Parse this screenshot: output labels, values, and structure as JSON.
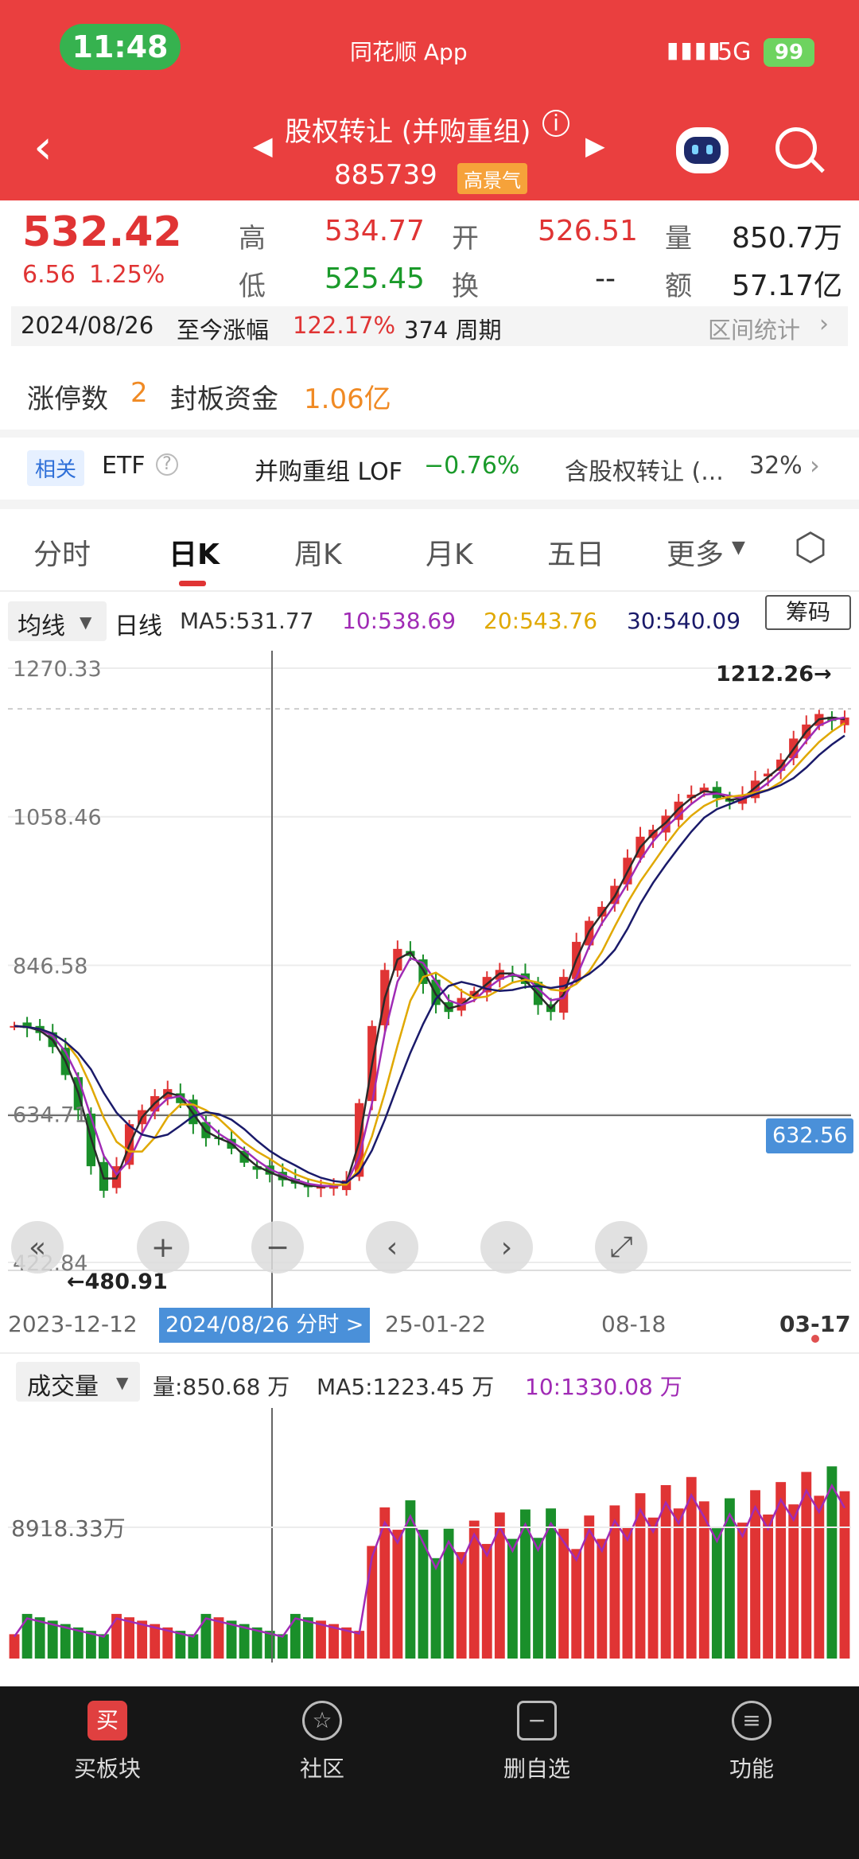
{
  "status": {
    "time": "11:48",
    "app": "同花顺 App",
    "network": "5G",
    "battery": "99"
  },
  "header": {
    "title": "股权转让 (并购重组)",
    "code": "885739",
    "badge": "高景气"
  },
  "quote": {
    "price": "532.42",
    "change": "6.56",
    "pct": "1.25%",
    "high_label": "高",
    "high": "534.77",
    "open_label": "开",
    "open": "526.51",
    "vol_label": "量",
    "vol": "850.7万",
    "low_label": "低",
    "low": "525.45",
    "turn_label": "换",
    "turn": "--",
    "amt_label": "额",
    "amt": "57.17亿",
    "range_date": "2024/08/26",
    "range_text": "至今涨幅",
    "range_pct": "122.17%",
    "range_weeks": "374 周期",
    "range_stat": "区间统计"
  },
  "limitup": {
    "count_label": "涨停数",
    "count": "2",
    "fund_label": "封板资金",
    "fund": "1.06亿"
  },
  "etf": {
    "tag": "相关",
    "etf": "ETF",
    "lof_name": "并购重组 LOF",
    "lof_pct": "−0.76%",
    "hold_name": "含股权转让 (...",
    "hold_pct": "32%"
  },
  "tabs": [
    "分时",
    "日K",
    "周K",
    "月K",
    "五日",
    "更多"
  ],
  "ma": {
    "selector": "均线",
    "label": "日线",
    "ma5": "MA5:531.77",
    "ma10": "10:538.69",
    "ma20": "20:543.76",
    "ma30": "30:540.09",
    "chips": "筹码"
  },
  "colors": {
    "up": "#e03434",
    "down": "#1a8f2a",
    "ma5": "#2a2a2a",
    "ma10": "#a02bb5",
    "ma20": "#e0a800",
    "ma30": "#1a1a6a",
    "cursor": "#4a90d9"
  },
  "chart_data": {
    "type": "candlestick",
    "y_ticks": [
      "1270.33",
      "1058.46",
      "846.58",
      "634.71",
      "422.84"
    ],
    "y_tick_values": [
      1270.33,
      1058.46,
      846.58,
      634.71,
      422.84
    ],
    "x_ticks": [
      "2023-12-12",
      "25-01-22",
      "08-18",
      "03-17"
    ],
    "max_label": "1212.26→",
    "min_label": "←480.91",
    "max": 1212.26,
    "min": 480.91,
    "cursor_price": "632.56",
    "cursor_date": "2024/08/26 分时 >",
    "ylim": [
      422.84,
      1270.33
    ],
    "closes": [
      760,
      757,
      750,
      730,
      690,
      640,
      560,
      525,
      560,
      620,
      640,
      660,
      670,
      650,
      620,
      600,
      600,
      585,
      565,
      555,
      548,
      540,
      535,
      530,
      532,
      532,
      540,
      650,
      760,
      840,
      870,
      860,
      820,
      790,
      780,
      800,
      810,
      830,
      840,
      830,
      820,
      790,
      780,
      830,
      880,
      910,
      930,
      960,
      1000,
      1030,
      1040,
      1060,
      1080,
      1090,
      1100,
      1085,
      1080,
      1090,
      1110,
      1120,
      1140,
      1170,
      1190,
      1205,
      1195,
      1200
    ]
  },
  "volume": {
    "selector": "成交量",
    "vol": "量:850.68 万",
    "ma5": "MA5:1223.45 万",
    "ma10": "10:1330.08 万",
    "tick": "8918.33万"
  },
  "nav": [
    {
      "icon": "买",
      "label": "买板块"
    },
    {
      "icon": "☆",
      "label": "社区"
    },
    {
      "icon": "−",
      "label": "删自选"
    },
    {
      "icon": "≡",
      "label": "功能"
    }
  ]
}
